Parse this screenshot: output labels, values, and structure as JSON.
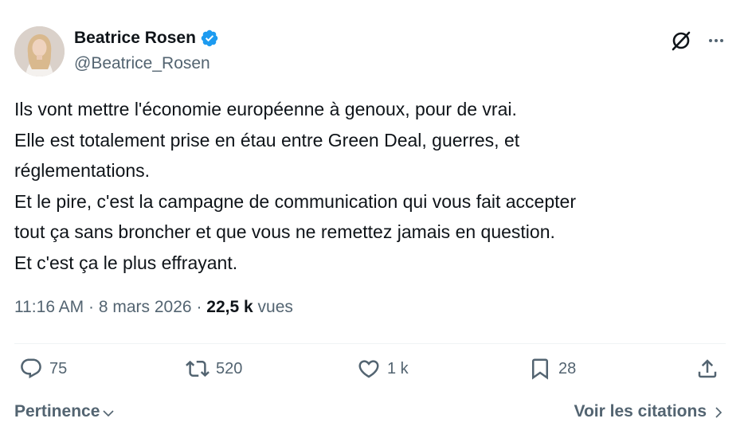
{
  "author": {
    "display_name": "Beatrice Rosen",
    "handle": "@Beatrice_Rosen",
    "verified": true
  },
  "tweet": {
    "lines": [
      "Ils vont mettre l'économie européenne à genoux, pour de vrai.",
      "Elle est totalement prise en étau entre Green Deal, guerres, et",
      "réglementations.",
      "Et le pire, c'est la campagne de communication qui vous fait accepter",
      "tout ça sans broncher et que vous ne remettez jamais en question.",
      "Et c'est ça le plus effrayant."
    ]
  },
  "meta": {
    "time": "11:16 AM",
    "separator": "·",
    "date": "8 mars 2026",
    "views_count": "22,5 k",
    "views_label": "vues"
  },
  "actions": {
    "replies": "75",
    "reposts": "520",
    "likes": "1 k",
    "bookmarks": "28"
  },
  "footer": {
    "sort_label": "Pertinence",
    "quotes_label": "Voir les citations"
  },
  "icons": {
    "verified": "verified-badge-icon",
    "grok": "grok-icon",
    "more": "more-icon",
    "reply": "reply-icon",
    "repost": "repost-icon",
    "like": "heart-icon",
    "bookmark": "bookmark-icon",
    "share": "share-icon"
  },
  "colors": {
    "text": "#0f1419",
    "secondary": "#536471",
    "verified": "#1d9bf0",
    "divider": "#eff3f4"
  }
}
